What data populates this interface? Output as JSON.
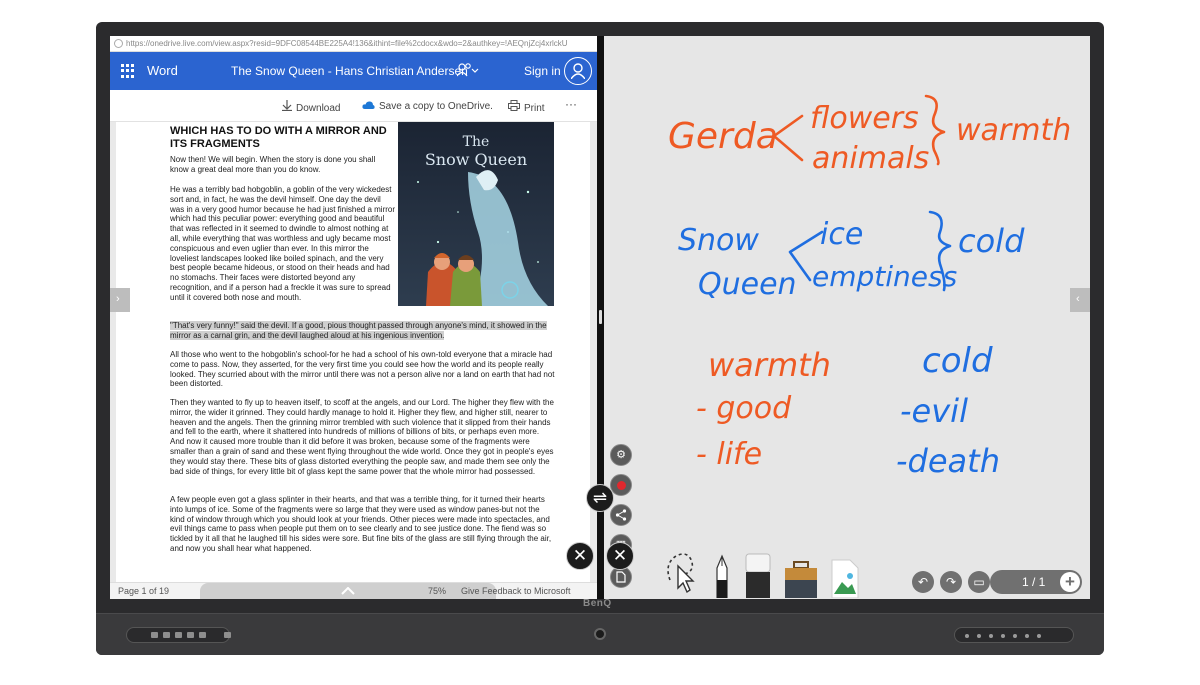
{
  "browser": {
    "url": "https://onedrive.live.com/view.aspx?resid=9DFC08544BE225A4!136&ithint=file%2cdocx&wdo=2&authkey=!AEQnjZcj4xrlckU"
  },
  "word": {
    "app_name": "Word",
    "doc_title": "The Snow Queen - Hans Christian Andersen",
    "sign_in": "Sign in",
    "ribbon": {
      "download": "Download",
      "save_copy": "Save a copy to OneDrive.",
      "print": "Print",
      "more": "···"
    },
    "document": {
      "heading": "WHICH HAS TO DO WITH A MIRROR AND ITS FRAGMENTS",
      "p1": "Now then! We will begin. When the story is done you shall know a great deal more than you do know.",
      "p2": "He was a terribly bad hobgoblin, a goblin of the very wickedest sort and, in fact, he was the devil himself. One day the devil was in a very good humor because he had just finished a mirror which had this peculiar power: everything good and beautiful that was reflected in it seemed to dwindle to almost nothing at all, while everything that was worthless and ugly became most conspicuous and even uglier than ever. In this mirror the loveliest landscapes looked like boiled spinach, and the very best people became hideous, or stood on their heads and had no stomachs. Their faces were distorted beyond any recognition, and if a person had a freckle it was sure to spread until it covered both nose and mouth.",
      "p3": "\"That's very funny!\" said the devil. If a good, pious thought passed through anyone's mind, it showed in the mirror as a carnal grin, and the devil laughed aloud at his ingenious invention.",
      "p4": "All those who went to the hobgoblin's school-for he had a school of his own-told everyone that a miracle had come to pass. Now, they asserted, for the very first time you could see how the world and its people really looked. They scurried about with the mirror until there was not a person alive nor a land on earth that had not been distorted.",
      "p5": "Then they wanted to fly up to heaven itself, to scoff at the angels, and our Lord. The higher they flew with the mirror, the wider it grinned. They could hardly manage to hold it. Higher they flew, and higher still, nearer to heaven and the angels. Then the grinning mirror trembled with such violence that it slipped from their hands and fell to the earth, where it shattered into hundreds of millions of billions of bits, or perhaps even more. And now it caused more trouble than it did before it was broken, because some of the fragments were smaller than a grain of sand and these went flying throughout the wide world. Once they got in people's eyes they would stay there. These bits of glass distorted everything the people saw, and made them see only the bad side of things, for every little bit of glass kept the same power that the whole mirror had possessed.",
      "p6": "A few people even got a glass splinter in their hearts, and that was a terrible thing, for it turned their hearts into lumps of ice. Some of the fragments were so large that they were used as window panes-but not the kind of window through which you should look at your friends. Other pieces were made into spectacles, and evil things came to pass when people put them on to see clearly and to see justice done. The fiend was so tickled by it all that he laughed till his sides were sore. But fine bits of the glass are still flying through the air, and now you shall hear what happened.",
      "cover_title_1": "The",
      "cover_title_2": "Snow Queen"
    },
    "status": {
      "page": "Page 1 of 19",
      "zoom": "75%",
      "feedback": "Give Feedback to Microsoft"
    }
  },
  "whiteboard": {
    "notes": {
      "gerda": "Gerda",
      "flowers": "flowers",
      "animals": "animals",
      "warmth_top": "warmth",
      "snow": "Snow",
      "queen": "Queen",
      "ice": "ice",
      "emptiness": "emptiness",
      "cold_top": "cold",
      "warmth_col": "warmth",
      "good": "- good",
      "life": "- life",
      "cold_col": "cold",
      "evil": "-evil",
      "death": "-death"
    },
    "page_indicator": "1 / 1"
  },
  "device": {
    "brand": "BenQ"
  },
  "colors": {
    "word_blue": "#2b64d0",
    "ink_orange": "#ee5a24",
    "ink_blue": "#1f6ee0"
  }
}
